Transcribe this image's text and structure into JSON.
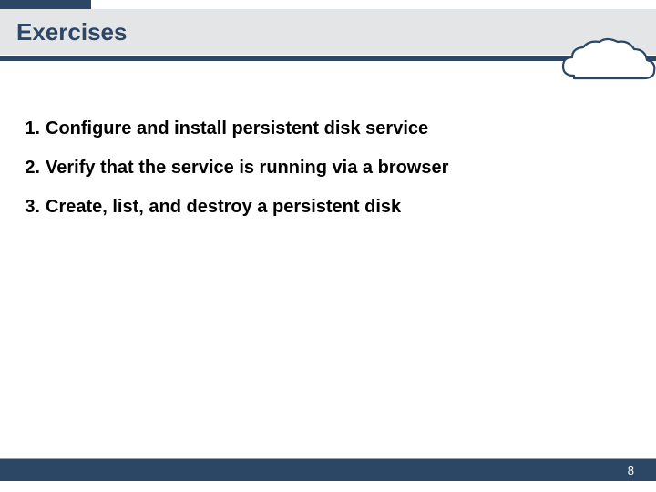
{
  "title": "Exercises",
  "bullets": [
    {
      "num": "1.",
      "text": "Configure and install persistent disk service"
    },
    {
      "num": "2.",
      "text": "Verify that the service is running via a browser"
    },
    {
      "num": "3.",
      "text": "Create, list, and destroy a persistent disk"
    }
  ],
  "page_number": "8",
  "colors": {
    "accent": "#2c4766",
    "band": "#e3e5e6"
  }
}
